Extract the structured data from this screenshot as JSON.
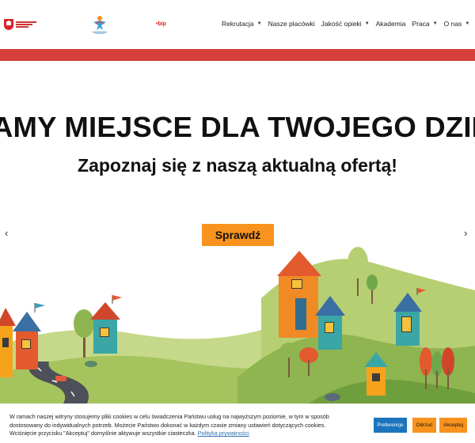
{
  "header": {
    "bip_label": "bip",
    "nav": [
      {
        "label": "Rekrutacja",
        "dropdown": true
      },
      {
        "label": "Nasze placówki",
        "dropdown": false
      },
      {
        "label": "Jakość opieki",
        "dropdown": true
      },
      {
        "label": "Akademia",
        "dropdown": false
      },
      {
        "label": "Praca",
        "dropdown": true
      },
      {
        "label": "O nas",
        "dropdown": true
      }
    ],
    "more": "···"
  },
  "hero": {
    "title": "AMY MIEJSCE DLA TWOJEGO DZIECKA",
    "subtitle": "Zapoznaj się z naszą aktualną ofertą!",
    "cta_label": "Sprawdź",
    "prev_icon": "‹",
    "next_icon": "›"
  },
  "cookie": {
    "text": "W ramach naszej witryny stosujemy pliki cookies w celu świadczenia Państwu usług na najwyższym poziomie, w tym w sposób dostosowany do indywidualnych potrzeb. Możecie Państwo dokonać w każdym czasie zmiany ustawień dotyczących cookies. Wciśnięcie przycisku \"Akceptuj\" domyślnie aktywuje wszystkie ciasteczka. ",
    "policy_link": "Polityka prywatności",
    "preferences": "Preferencje",
    "reject": "Odrzuć",
    "accept": "Akceptuj"
  },
  "colors": {
    "accent_red": "#d63f3b",
    "cta_orange": "#f7931e",
    "pref_blue": "#1c75bc"
  }
}
